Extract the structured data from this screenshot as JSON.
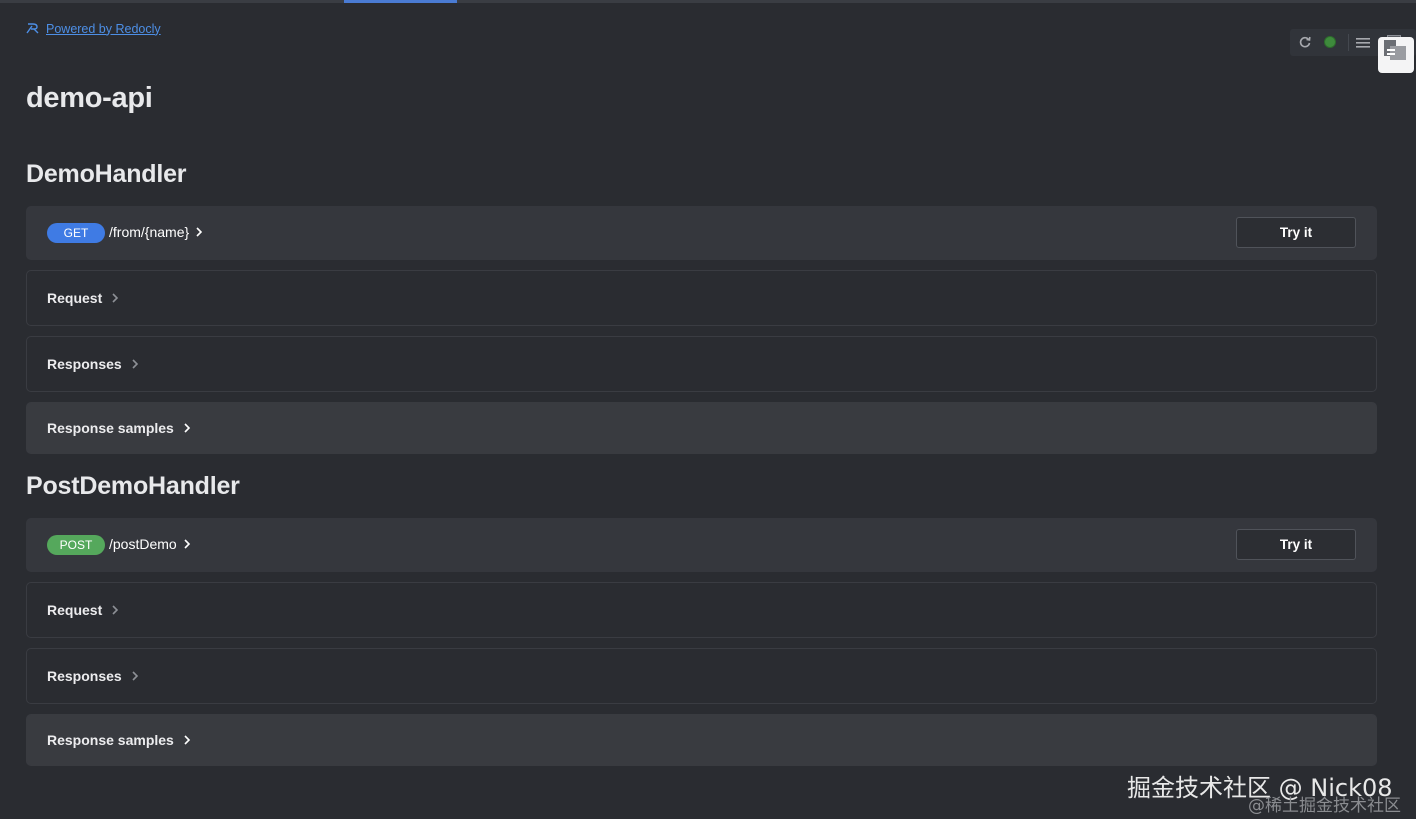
{
  "powered_by": {
    "label": "Powered by Redocly"
  },
  "api": {
    "title": "demo-api"
  },
  "sections": [
    {
      "title": "DemoHandler",
      "operation": {
        "method": "GET",
        "path": "/from/{name}",
        "try_label": "Try it"
      },
      "panels": [
        "Request",
        "Responses",
        "Response samples"
      ]
    },
    {
      "title": "PostDemoHandler",
      "operation": {
        "method": "POST",
        "path": "/postDemo",
        "try_label": "Try it"
      },
      "panels": [
        "Request",
        "Responses",
        "Response samples"
      ]
    }
  ],
  "watermark": {
    "line1": "掘金技术社区 @ Nick08",
    "line2": "@稀土掘金技术社区"
  },
  "colors": {
    "background": "#2a2c31",
    "get": "#3f7be4",
    "post": "#55a85c",
    "link": "#4d8fe6"
  },
  "icons": [
    "redocly-logo-icon",
    "refresh-icon",
    "status-dot-icon",
    "menu-icon",
    "panel-icon",
    "chevron-right-icon"
  ]
}
